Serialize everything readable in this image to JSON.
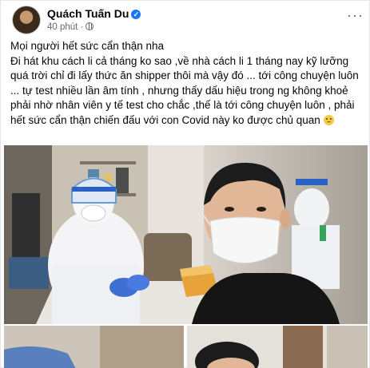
{
  "post": {
    "author": "Quách Tuấn Du",
    "time": "40 phút",
    "verified_icon": "verified-badge-icon",
    "privacy_icon": "globe-icon",
    "more_label": "···",
    "text_line1": "Mọi người hết sức cẩn thận nha",
    "text_body": "Đi hát khu cách li cả tháng ko sao ,về nhà cách li 1 tháng nay kỹ lưỡng quá trời chỉ đi lấy thức ăn shipper thôi mà vậy đó ... tới công chuyện luôn ... tự test nhiều lần âm tính , nhưng thấy dấu hiệu trong ng không khoẻ phải nhờ nhân viên y tế test cho chắc ,thế là tới công chuyện luôn , phải hết sức cẩn thận chiến đấu với con Covid này ko được chủ quan",
    "emoji": "sad-face-emoji"
  },
  "photos": {
    "main_alt": "Man wearing white face mask taking selfie with health worker in protective suit",
    "thumb_left_alt": "Cropped photo thumbnail",
    "thumb_right_alt": "Cropped photo thumbnail"
  },
  "colors": {
    "brand": "#1877f2",
    "meta_text": "#65676b",
    "text": "#050505"
  }
}
